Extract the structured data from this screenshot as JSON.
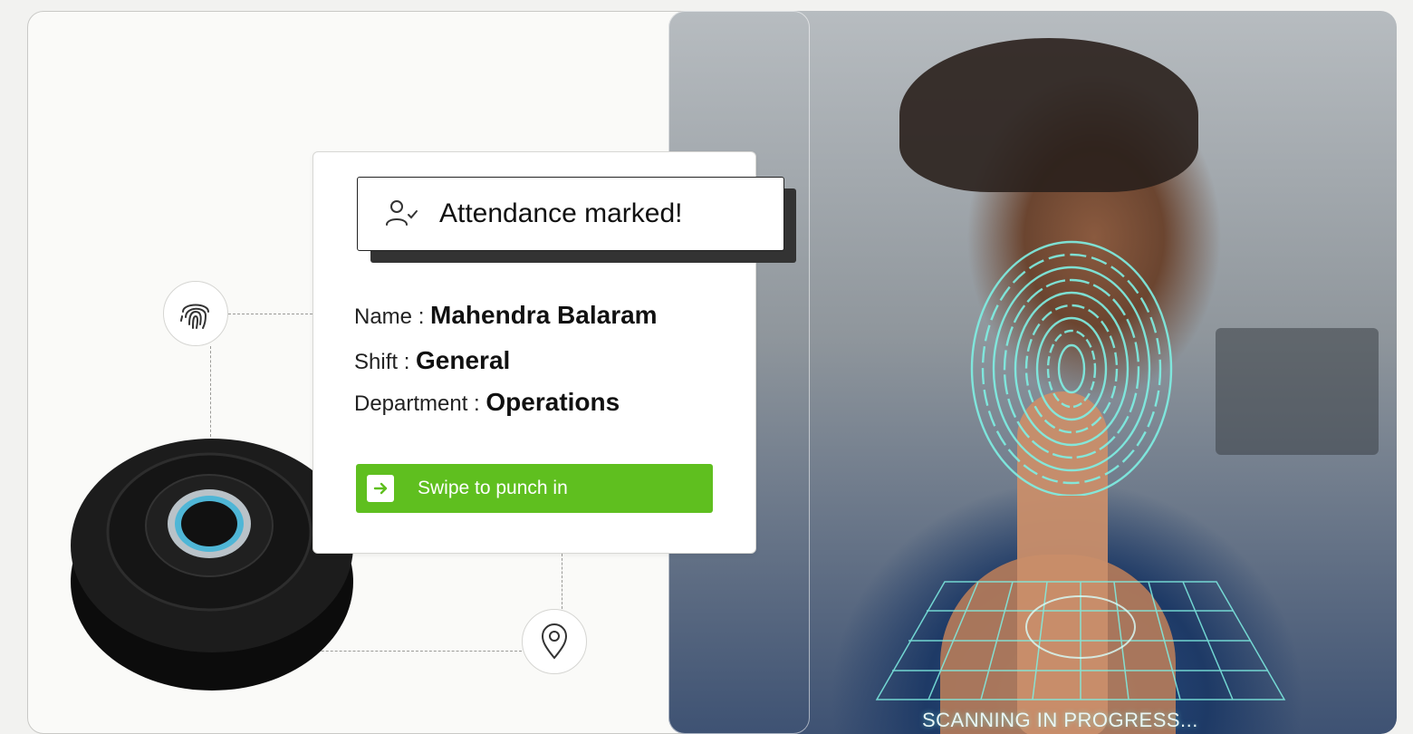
{
  "toast": {
    "icon": "user-check-icon",
    "text": "Attendance marked!"
  },
  "employee": {
    "name_label": "Name : ",
    "name_value": "Mahendra Balaram",
    "shift_label": "Shift : ",
    "shift_value": "General",
    "department_label": "Department : ",
    "department_value": "Operations"
  },
  "swipe": {
    "icon": "arrow-right-icon",
    "label": "Swipe to punch in"
  },
  "badges": {
    "fingerprint": "fingerprint-icon",
    "location": "location-pin-icon"
  },
  "scan": {
    "status": "SCANNING IN PROGRESS..."
  },
  "colors": {
    "accent_green": "#5fbf1f",
    "scan_cyan": "#7ff0e4"
  }
}
